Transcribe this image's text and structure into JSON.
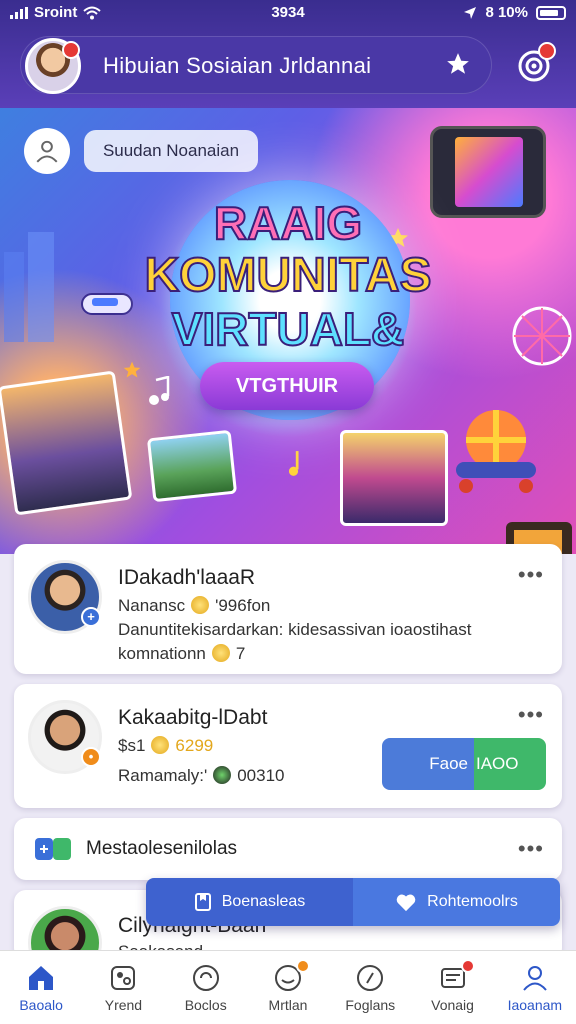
{
  "status_bar": {
    "carrier": "Sroint",
    "time": "3934",
    "battery": "10%",
    "battery_prefix": "8"
  },
  "header": {
    "title": "Hibuian Sosiaian Jrldannai",
    "star_icon": "star-icon",
    "notify_icon": "notification-icon"
  },
  "banner": {
    "user_chip": "Suudan Noanaian",
    "title_line1": "RAAIG",
    "title_line2": "KOMUNITAS",
    "title_line3": "VIRTUAL&",
    "button": "VTGTHUIR"
  },
  "cards": [
    {
      "name": "IDakadh'laaaR",
      "line1_a": "Nanansc",
      "line1_b": "'996fon",
      "line2": "Danuntitekisardarkan: kidesassivan ioaostihast",
      "line3_a": "komnationn",
      "line3_b": "7"
    },
    {
      "name": "Kakaabitg-lDabt",
      "line1_a": "$s1",
      "line1_b": "6299",
      "line2_a": "Ramamaly:'",
      "line2_b": "00310",
      "follow_a": "Faoe",
      "follow_b": "IAOO"
    },
    {
      "name": "Mestaolesenilolas"
    },
    {
      "name": "Cilynaight-Baan",
      "line1": "Saakasand"
    }
  ],
  "action_bar": {
    "left_label": "Boenasleas",
    "right_label": "Rohtemoolrs"
  },
  "nav": [
    {
      "label": "Baoalo",
      "icon": "home-icon"
    },
    {
      "label": "Yrend",
      "icon": "trend-icon"
    },
    {
      "label": "Boclos",
      "icon": "games-icon"
    },
    {
      "label": "Mrtlan",
      "icon": "chat-icon"
    },
    {
      "label": "Foglans",
      "icon": "compass-icon"
    },
    {
      "label": "Vonaig",
      "icon": "messages-icon"
    },
    {
      "label": "Iaoanam",
      "icon": "profile-icon"
    }
  ],
  "colors": {
    "accent": "#2d57c8",
    "header": "#4a38a6",
    "green": "#3fb86a",
    "badge": "#e53935"
  }
}
